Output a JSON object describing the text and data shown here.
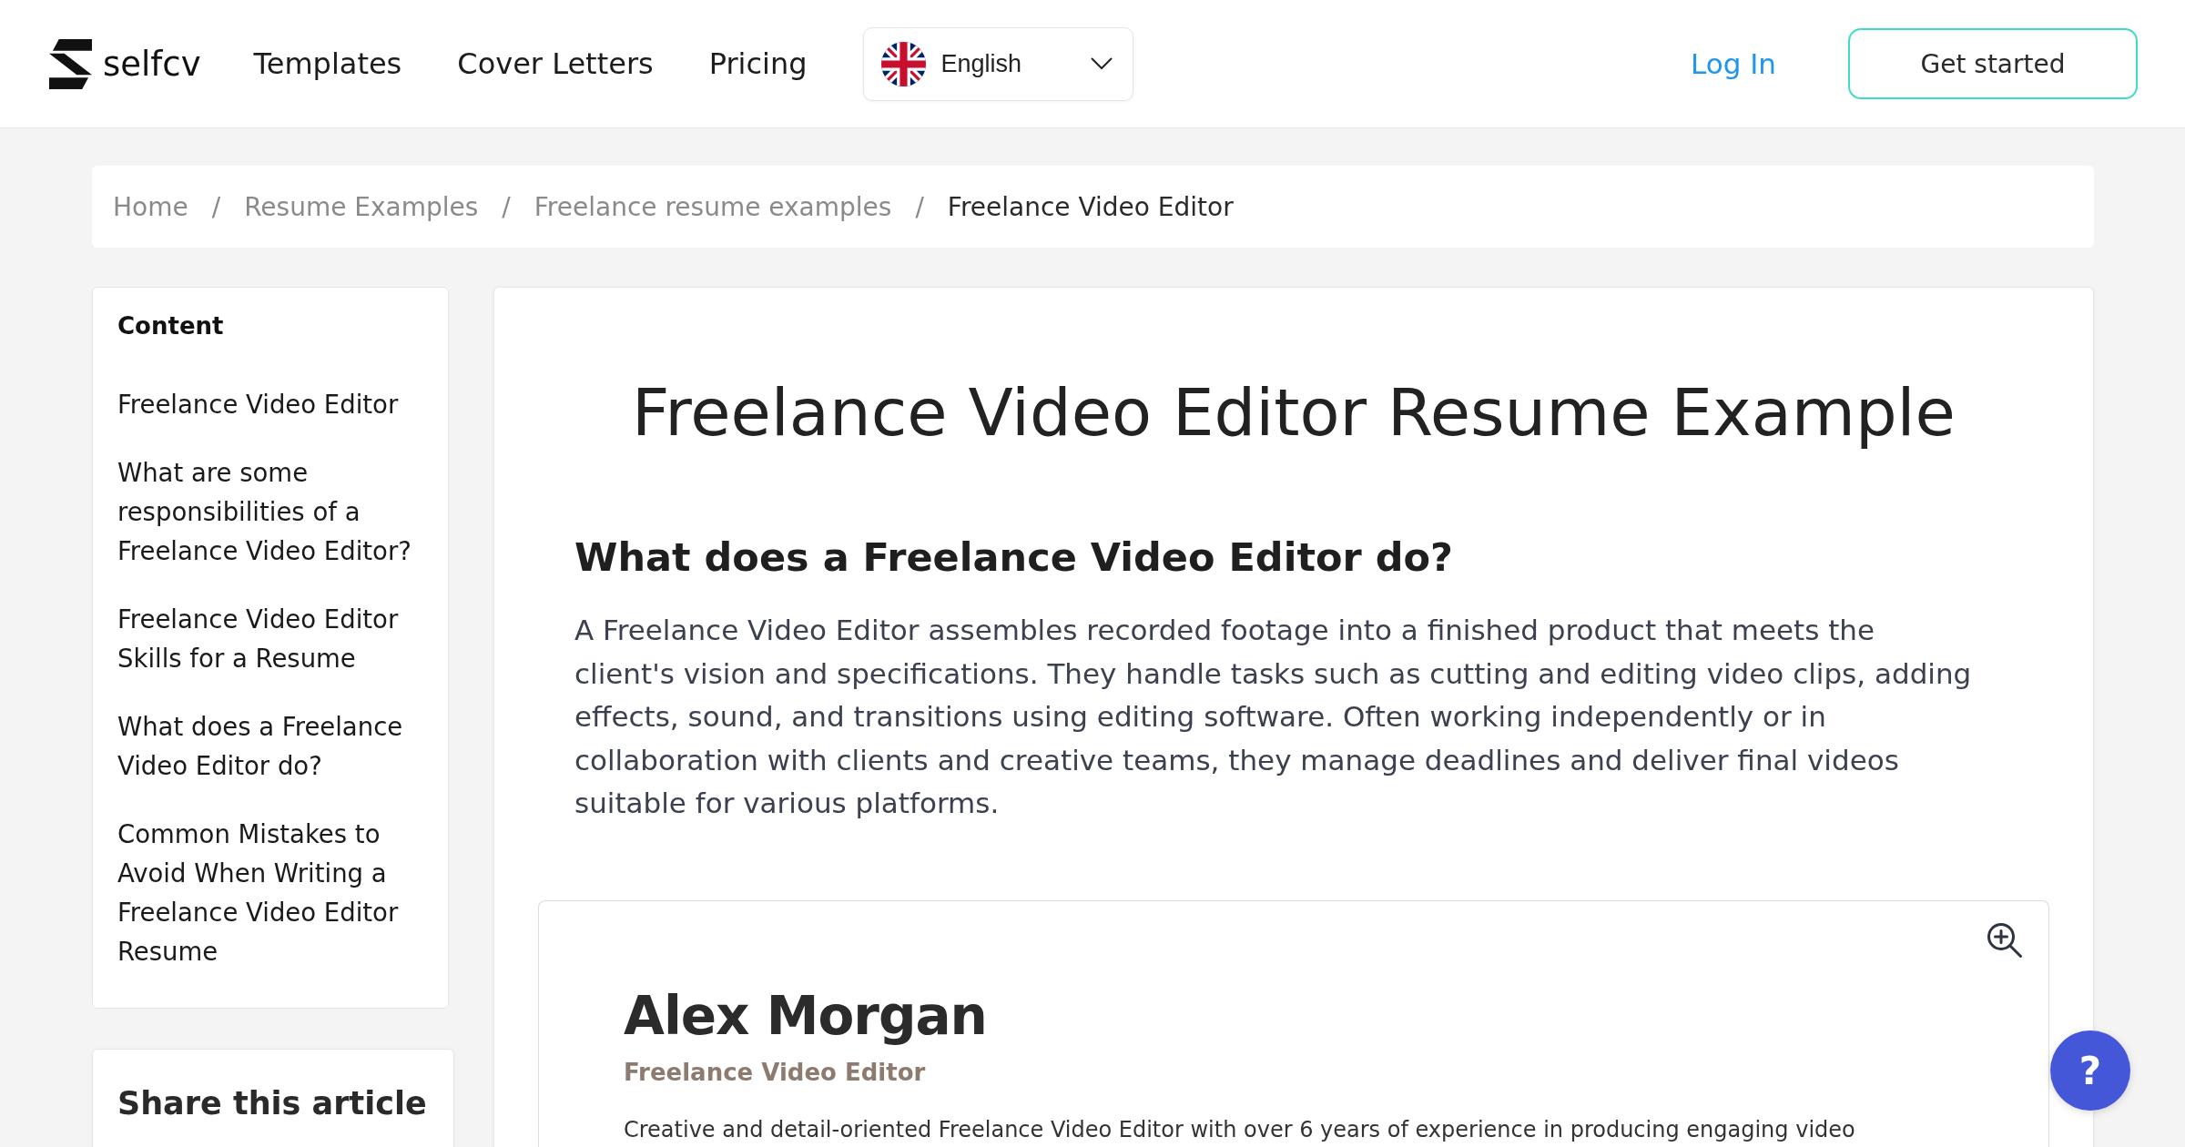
{
  "header": {
    "logo_text": "selfcv",
    "nav": [
      {
        "label": "Templates"
      },
      {
        "label": "Cover Letters"
      },
      {
        "label": "Pricing"
      }
    ],
    "language": {
      "value": "English"
    },
    "login": "Log In",
    "cta": "Get started"
  },
  "breadcrumb": [
    {
      "label": "Home",
      "current": false
    },
    {
      "separator": "/",
      "label": "Resume Examples",
      "current": false
    },
    {
      "separator": "/",
      "label": "Freelance resume examples",
      "current": false
    },
    {
      "separator": "/",
      "label": "Freelance Video Editor",
      "current": true
    }
  ],
  "sidebar": {
    "contents": {
      "title": "Content",
      "items": [
        "Freelance Video Editor",
        "What are some responsibilities of a Freelance Video Editor?",
        "Freelance Video Editor Skills for a Resume",
        "What does a Freelance Video Editor do?",
        "Common Mistakes to Avoid When Writing a Freelance Video Editor Resume"
      ]
    },
    "share": {
      "title": "Share this article"
    }
  },
  "article": {
    "title": "Freelance Video Editor Resume Example",
    "section": {
      "heading": "What does a Freelance Video Editor do?",
      "paragraph": "A Freelance Video Editor assembles recorded footage into a finished product that meets the client's vision and specifications. They handle tasks such as cutting and editing video clips, adding effects, sound, and transitions using editing software. Often working independently or in collaboration with clients and creative teams, they manage deadlines and deliver final videos suitable for various platforms."
    },
    "resume_preview": {
      "name": "Alex Morgan",
      "role": "Freelance Video Editor",
      "summary": "Creative and detail-oriented Freelance Video Editor with over 6 years of experience in producing engaging video"
    }
  },
  "help_button": {
    "label": "?"
  }
}
